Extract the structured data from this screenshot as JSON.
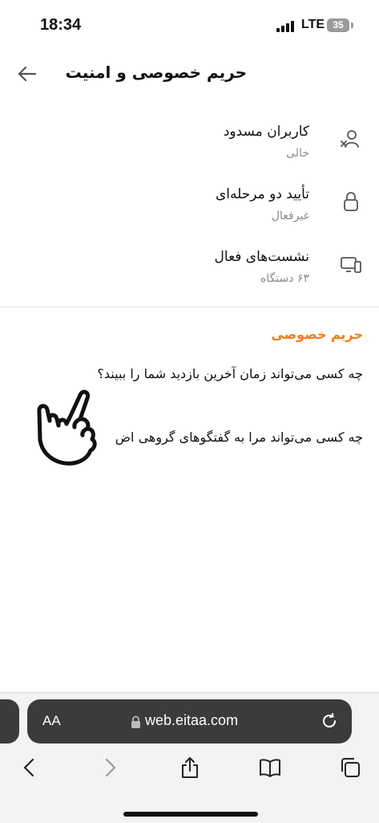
{
  "status_bar": {
    "time": "18:34",
    "network": "LTE",
    "battery": "35"
  },
  "header": {
    "title": "حریم خصوصی و امنیت"
  },
  "security_items": [
    {
      "label": "کاربران مسدود",
      "value": "خالی",
      "icon": "blocked-user-icon"
    },
    {
      "label": "تأیید دو مرحله‌ای",
      "value": "غیرفعال",
      "icon": "lock-icon"
    },
    {
      "label": "نشست‌های فعال",
      "value": "۶۳ دستگاه",
      "icon": "devices-icon"
    }
  ],
  "privacy": {
    "section_title": "حریم خصوصی",
    "items": [
      "چه کسی می‌تواند زمان آخرین بازدید شما را ببیند؟",
      "چه کسی می‌تواند مرا به گفتگوهای گروهی اض"
    ]
  },
  "browser": {
    "text_size_label": "AA",
    "url": "web.eitaa.com",
    "bar_color": "#3b3b3d",
    "accent_color": "#f07c14"
  }
}
